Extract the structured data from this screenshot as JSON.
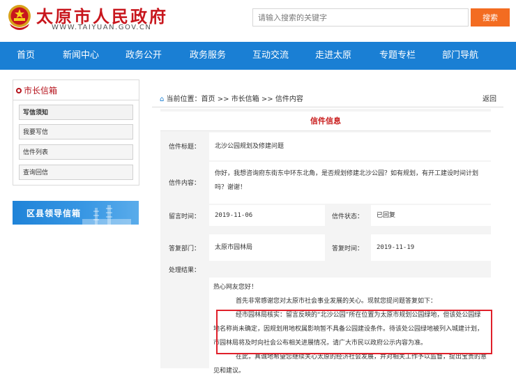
{
  "header": {
    "site_name": "太原市人民政府",
    "site_url": "WWW.TAIYUAN.GOV.CN",
    "emblem_icon": "national-emblem-icon",
    "search_placeholder": "请输入搜索的关键字",
    "search_button": "搜索"
  },
  "nav": {
    "items": [
      {
        "label": "首页"
      },
      {
        "label": "新闻中心"
      },
      {
        "label": "政务公开"
      },
      {
        "label": "政务服务"
      },
      {
        "label": "互动交流"
      },
      {
        "label": "走进太原"
      },
      {
        "label": "专题专栏"
      },
      {
        "label": "部门导航"
      }
    ]
  },
  "sidebar": {
    "title": "市长信箱",
    "items": [
      {
        "label": "写信须知"
      },
      {
        "label": "我要写信"
      },
      {
        "label": "信件列表"
      },
      {
        "label": "查询回信"
      }
    ],
    "banner": "区县领导信箱"
  },
  "breadcrumb": {
    "prefix": "当前位置：",
    "home": "首页",
    "sep1": ">>",
    "mailbox": "市长信箱",
    "sep2": ">>",
    "current": "信件内容",
    "back": "返回"
  },
  "letter": {
    "section_title": "信件信息",
    "title_label": "信件标题：",
    "title_value": "北沙公园规划及修建问题",
    "content_label": "信件内容：",
    "content_value": "你好，我想咨询府东街东中环东北角，是否规划修建北沙公园？如有规划，有开工建设时间计划吗？谢谢！",
    "message_time_label": "留言时间：",
    "message_time_value": "2019-11-06",
    "status_label": "信件状态：",
    "status_value": "已回复",
    "dept_label": "答复部门：",
    "dept_value": "太原市园林局",
    "reply_time_label": "答复时间：",
    "reply_time_value": "2019-11-19",
    "result_label": "处理结果：",
    "result_p1": "热心网友您好！",
    "result_p2": "首先非常感谢您对太原市社会事业发展的关心。现就您提问题答复如下：",
    "result_p3": "经市园林局核实：留言反映的“北沙公园”所在位置为太原市规划公园绿地，但该处公园绿地名称尚未确定，因规划用地权属影响暂不具备公园建设条件。待该处公园绿地被列入城建计划，市园林局将及时向社会公布相关进展情况，请广大市民以政府公示内容为准。",
    "result_p4": "在此，真诚地希望您继续关心太原的经济社会发展，并对相关工作予以监督，提出宝贵的意见和建议。"
  },
  "colors": {
    "nav_blue": "#1a7fd4",
    "brand_red": "#c8161d",
    "search_orange": "#f36c21",
    "highlight_red": "#e0202a"
  }
}
